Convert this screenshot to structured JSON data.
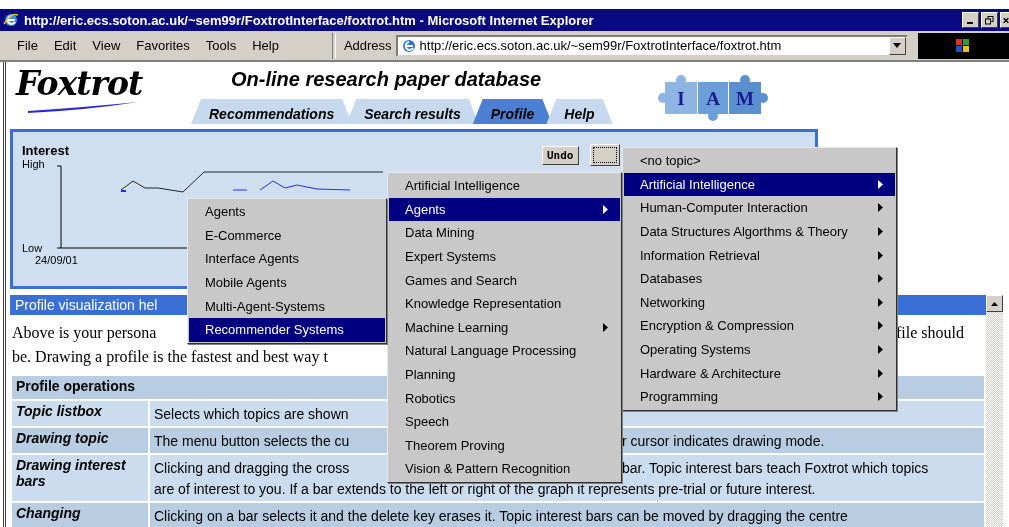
{
  "window": {
    "title": "http://eric.ecs.soton.ac.uk/~sem99r/FoxtrotInterface/foxtrot.htm - Microsoft Internet Explorer"
  },
  "menu_bar": [
    "File",
    "Edit",
    "View",
    "Favorites",
    "Tools",
    "Help"
  ],
  "address_bar": {
    "label": "Address",
    "value": "http://eric.ecs.soton.ac.uk/~sem99r/FoxtrotInterface/foxtrot.htm"
  },
  "header": {
    "logo": "Foxtrot",
    "heading": "On-line research paper database",
    "partner_logo": [
      "I",
      "A",
      "M"
    ],
    "tabs": [
      {
        "label": "Recommendations",
        "selected": false
      },
      {
        "label": "Search results",
        "selected": false
      },
      {
        "label": "Profile",
        "selected": true
      },
      {
        "label": "Help",
        "selected": false
      }
    ]
  },
  "graph": {
    "title": "Interest",
    "y_high": "High",
    "y_low": "Low",
    "start_date": "24/09/01",
    "undo_button": "Undo"
  },
  "help_bar": "Profile visualization hel",
  "intro": {
    "line_1": [
      "Above is your persona",
      "file should"
    ],
    "line_2": "be. Drawing a profile is the fastest and best way t"
  },
  "table": {
    "title": "Profile operations",
    "rows": [
      {
        "term": "Topic listbox",
        "lines": [
          [
            "Selects which topics are shown"
          ]
        ]
      },
      {
        "term": "Drawing topic",
        "lines": [
          [
            "The menu button selects the cu",
            "r cursor indicates drawing mode."
          ]
        ]
      },
      {
        "term": "Drawing interest bars",
        "lines": [
          [
            "Clicking and dragging the cross",
            "bar. Topic interest bars teach Foxtrot which topics"
          ],
          [
            "are of interest to you. If a bar extends to the left or right of the graph it represents pre-trial or future interest."
          ]
        ]
      },
      {
        "term": "Changing",
        "lines": [
          [
            "Clicking on a bar selects it and the delete key erases it. Topic interest bars can be moved by dragging the centre"
          ]
        ]
      }
    ]
  },
  "topic_menus": [
    {
      "items": [
        {
          "label": "<no topic>",
          "submenu": false,
          "selected": false
        },
        {
          "label": "Artificial Intelligence",
          "submenu": true,
          "selected": true
        },
        {
          "label": "Human-Computer Interaction",
          "submenu": true,
          "selected": false
        },
        {
          "label": "Data Structures Algorthms & Theory",
          "submenu": true,
          "selected": false
        },
        {
          "label": "Information Retrieval",
          "submenu": true,
          "selected": false
        },
        {
          "label": "Databases",
          "submenu": true,
          "selected": false
        },
        {
          "label": "Networking",
          "submenu": true,
          "selected": false
        },
        {
          "label": "Encryption & Compression",
          "submenu": true,
          "selected": false
        },
        {
          "label": "Operating Systems",
          "submenu": true,
          "selected": false
        },
        {
          "label": "Hardware & Architecture",
          "submenu": true,
          "selected": false
        },
        {
          "label": "Programming",
          "submenu": true,
          "selected": false
        }
      ]
    },
    {
      "items": [
        {
          "label": "Artificial Intelligence",
          "submenu": false,
          "selected": false
        },
        {
          "label": "Agents",
          "submenu": true,
          "selected": true
        },
        {
          "label": "Data Mining",
          "submenu": false,
          "selected": false
        },
        {
          "label": "Expert Systems",
          "submenu": false,
          "selected": false
        },
        {
          "label": "Games and Search",
          "submenu": false,
          "selected": false
        },
        {
          "label": "Knowledge Representation",
          "submenu": false,
          "selected": false
        },
        {
          "label": "Machine Learning",
          "submenu": true,
          "selected": false
        },
        {
          "label": "Natural Language Processing",
          "submenu": false,
          "selected": false
        },
        {
          "label": "Planning",
          "submenu": false,
          "selected": false
        },
        {
          "label": "Robotics",
          "submenu": false,
          "selected": false
        },
        {
          "label": "Speech",
          "submenu": false,
          "selected": false
        },
        {
          "label": "Theorem Proving",
          "submenu": false,
          "selected": false
        },
        {
          "label": "Vision & Pattern Recognition",
          "submenu": false,
          "selected": false
        }
      ]
    },
    {
      "items": [
        {
          "label": "Agents",
          "submenu": false,
          "selected": false
        },
        {
          "label": "E-Commerce",
          "submenu": false,
          "selected": false
        },
        {
          "label": "Interface Agents",
          "submenu": false,
          "selected": false
        },
        {
          "label": "Mobile Agents",
          "submenu": false,
          "selected": false
        },
        {
          "label": "Multi-Agent-Systems",
          "submenu": false,
          "selected": false
        },
        {
          "label": "Recommender Systems",
          "submenu": false,
          "selected": true
        }
      ]
    }
  ]
}
